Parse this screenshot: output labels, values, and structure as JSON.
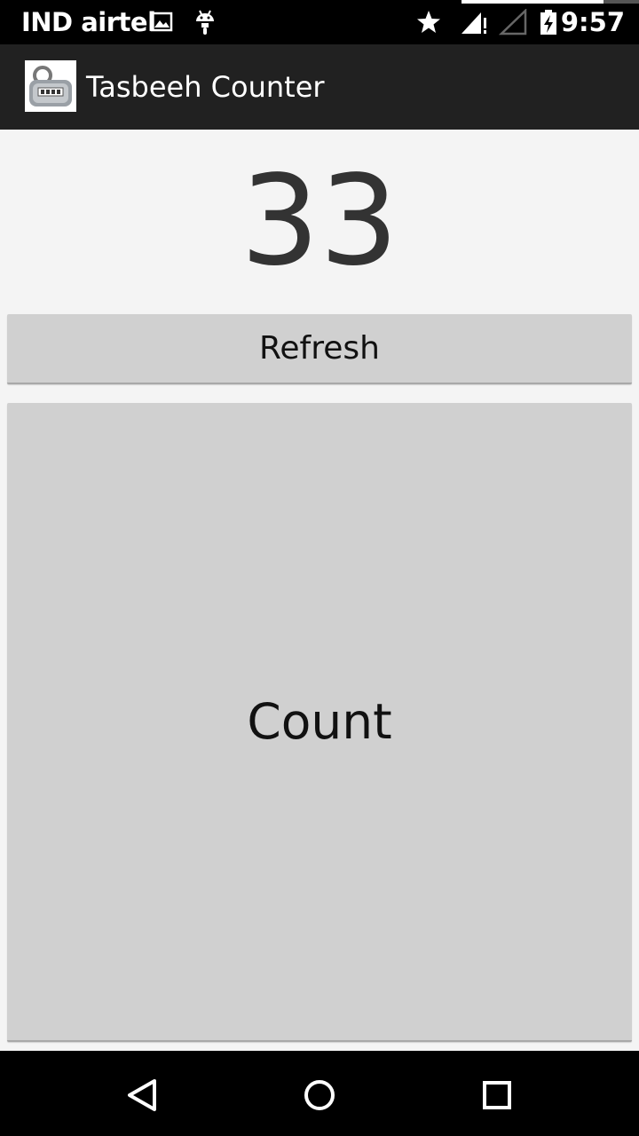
{
  "status_bar": {
    "carrier": "IND airtel",
    "time": "9:57",
    "icons": [
      "image-icon",
      "android-debug-icon",
      "star-icon",
      "signal-icon",
      "signal-empty-icon",
      "battery-charging-icon"
    ]
  },
  "action_bar": {
    "title": "Tasbeeh Counter",
    "icon": "tally-counter-icon"
  },
  "counter": {
    "value": "33"
  },
  "buttons": {
    "refresh_label": "Refresh",
    "count_label": "Count"
  },
  "nav_bar": {
    "icons": [
      "back-icon",
      "home-icon",
      "recents-icon"
    ]
  },
  "colors": {
    "background": "#f4f4f4",
    "action_bar": "#212121",
    "button": "#d0d0d0",
    "counter_text": "#333333"
  }
}
